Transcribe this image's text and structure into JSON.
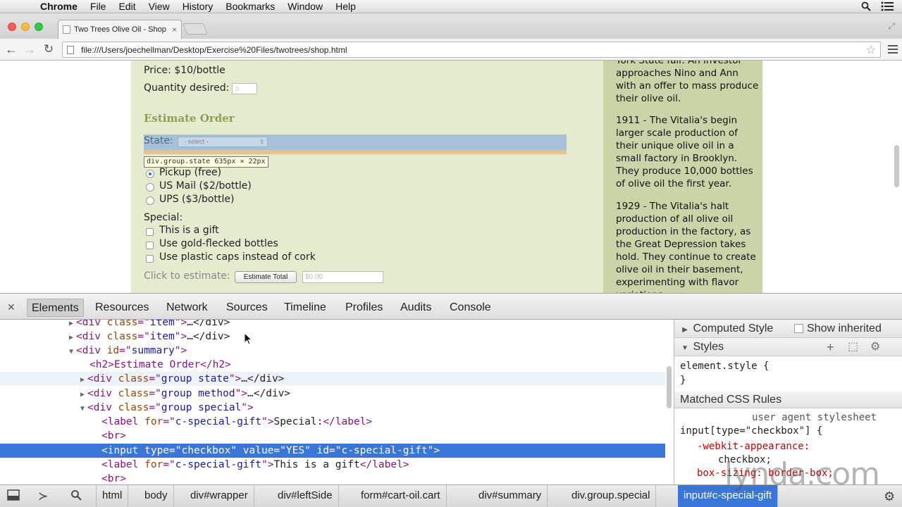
{
  "menubar": {
    "app_name": "Chrome",
    "items": [
      "File",
      "Edit",
      "View",
      "History",
      "Bookmarks",
      "Window",
      "Help"
    ]
  },
  "browser": {
    "tab_title": "Two Trees Olive Oil - Shop",
    "url": "file:///Users/joechellman/Desktop/Exercise%20Files/twotrees/shop.html"
  },
  "page": {
    "price": "Price: $10/bottle",
    "quantity_label": "Quantity desired:",
    "quantity_value": "0",
    "estimate_heading": "Estimate Order",
    "state_label": "State:",
    "state_select": "- select -",
    "tooltip": "div.group.state 635px × 22px",
    "shipping": [
      "Pickup (free)",
      "US Mail ($2/bottle)",
      "UPS ($3/bottle)"
    ],
    "special_label": "Special:",
    "special_options": [
      "This is a gift",
      "Use gold-flecked bottles",
      "Use plastic caps instead of cork"
    ],
    "click_label": "Click to estimate:",
    "estimate_button": "Estimate Total",
    "total_placeholder": "$0.00",
    "history": [
      "York State fair. An investor approaches Nino and Ann with an offer to mass produce their olive oil.",
      "1911 - The Vitalia's begin larger scale production of their unique olive oil in a small factory in Brooklyn. They produce 10,000 bottles of olive oil the first year.",
      "1929 - The Vitalia's halt production of all olive oil production in the factory, as the Great Depression takes hold. They continue to create olive oil in their basement, experimenting with flavor variations"
    ]
  },
  "devtools": {
    "tabs": [
      "Elements",
      "Resources",
      "Network",
      "Sources",
      "Timeline",
      "Profiles",
      "Audits",
      "Console"
    ],
    "nodes": [
      {
        "tag": "div",
        "attr": "class",
        "val": "item",
        "tail": "…</div>",
        "expand": "▶"
      },
      {
        "tag": "div",
        "attr": "class",
        "val": "item",
        "tail": "…</div>",
        "expand": "▶"
      },
      {
        "tag": "div",
        "attr": "id",
        "val": "summary",
        "tail": "",
        "expand": "▼"
      },
      {
        "text": "<h2>Estimate Order</h2>"
      },
      {
        "tag": "div",
        "attr": "class",
        "val": "group state",
        "tail": "…</div>",
        "expand": "▶"
      },
      {
        "tag": "div",
        "attr": "class",
        "val": "group method",
        "tail": "…</div>",
        "expand": "▶"
      },
      {
        "tag": "div",
        "attr": "class",
        "val": "group special",
        "tail": "",
        "expand": "▼"
      },
      {
        "label_for": "c-special-gift",
        "label_text": "Special:"
      },
      {
        "text": "<br>"
      },
      {
        "input": "<input type=\"checkbox\" value=\"YES\" id=\"c-special-gift\">"
      },
      {
        "label_for": "c-special-gift",
        "label_text": "This is a gift"
      },
      {
        "text": "<br>"
      }
    ],
    "styles": {
      "computed": "Computed Style",
      "show_inherited": "Show inherited",
      "styles_header": "Styles",
      "element_style": "element.style {",
      "close_brace": "}",
      "matched": "Matched CSS Rules",
      "ua": "user agent stylesheet",
      "selector": "input[type=\"checkbox\"] {",
      "prop1": "-webkit-appearance:",
      "val1": "checkbox;",
      "prop2": "box-sizing: border-box;"
    },
    "breadcrumbs": [
      "html",
      "body",
      "div#wrapper",
      "div#leftSide",
      "form#cart-oil.cart",
      "div#summary",
      "div.group.special",
      "input#c-special-gift"
    ]
  },
  "watermark": "lynda.com"
}
